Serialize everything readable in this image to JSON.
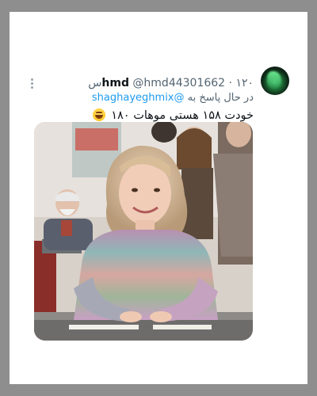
{
  "tweet": {
    "display_name": "hmd",
    "handle": "@hmd44301662",
    "separator": "·",
    "time": "۱۲۰س",
    "reply_prefix": "در حال پاسخ به",
    "reply_to": "@shaghayeghmix",
    "text": "خودت ۱۵۸ هستی موهات ۱۸۰",
    "emoji": "grinning-sweat-face-icon",
    "more_icon": "more-options-icon",
    "avatar_icon": "green-aurora-avatar"
  },
  "colors": {
    "background": "#8e8e8e",
    "card": "#ffffff",
    "text_primary": "#0f1419",
    "text_secondary": "#536471",
    "link": "#1d9bf0"
  }
}
